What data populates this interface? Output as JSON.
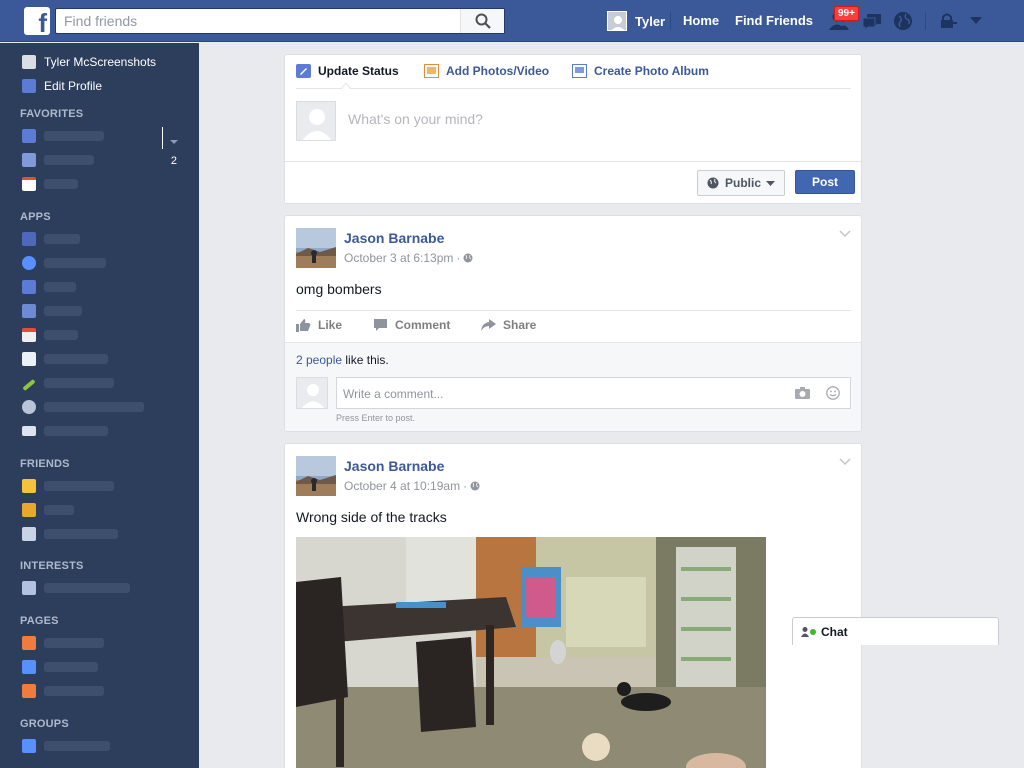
{
  "header": {
    "search_placeholder": "Find friends",
    "user_name": "Tyler",
    "home": "Home",
    "find_friends": "Find Friends",
    "friend_requests_badge": "99+",
    "colors": {
      "bar": "#3b5998",
      "badge": "#fa3e3e"
    }
  },
  "sidebar": {
    "profile_name": "Tyler McScreenshots",
    "edit_profile": "Edit Profile",
    "sections": {
      "favorites": "FAVORITES",
      "apps": "APPS",
      "friends": "FRIENDS",
      "interests": "INTERESTS",
      "pages": "PAGES",
      "groups": "GROUPS"
    },
    "favorites_messages_count": "2"
  },
  "composer": {
    "tab_update": "Update Status",
    "tab_photos": "Add Photos/Video",
    "tab_album": "Create Photo Album",
    "placeholder": "What's on your mind?",
    "privacy": "Public",
    "post": "Post"
  },
  "stories": [
    {
      "author": "Jason Barnabe",
      "time": "October 3 at 6:13pm",
      "text": "omg bombers",
      "like": "Like",
      "comment": "Comment",
      "share": "Share",
      "likes_link": "2 people",
      "likes_suffix": "like this.",
      "comment_placeholder": "Write a comment...",
      "press_enter": "Press Enter to post."
    },
    {
      "author": "Jason Barnabe",
      "time": "October 4 at 10:19am",
      "text": "Wrong side of the tracks"
    }
  ],
  "chat": {
    "label": "Chat"
  }
}
